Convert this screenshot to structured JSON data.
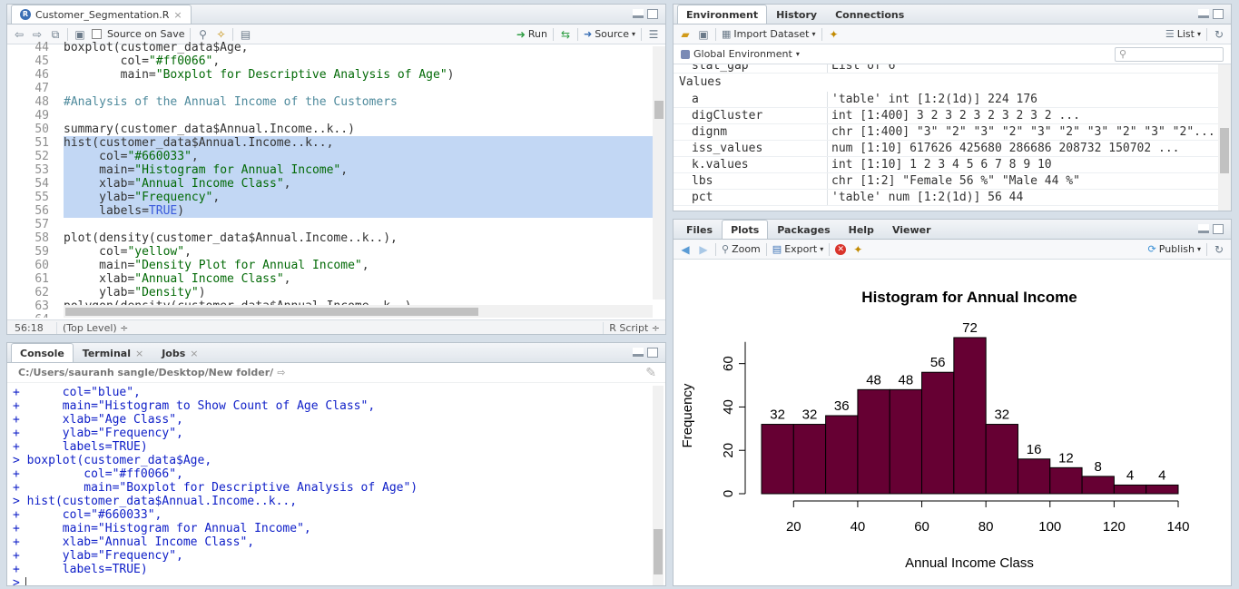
{
  "source_pane": {
    "tab_label": "Customer_Segmentation.R",
    "toolbar": {
      "source_on_save": "Source on Save",
      "run": "Run",
      "source": "Source"
    },
    "lines": [
      {
        "n": "44",
        "parts": [
          {
            "t": "boxplot(customer_data$Age,",
            "c": ""
          }
        ]
      },
      {
        "n": "45",
        "parts": [
          {
            "t": "        col=",
            "c": ""
          },
          {
            "t": "\"#ff0066\"",
            "c": "str"
          },
          {
            "t": ",",
            "c": ""
          }
        ]
      },
      {
        "n": "46",
        "parts": [
          {
            "t": "        main=",
            "c": ""
          },
          {
            "t": "\"Boxplot for Descriptive Analysis of Age\"",
            "c": "str"
          },
          {
            "t": ")",
            "c": ""
          }
        ]
      },
      {
        "n": "47",
        "parts": []
      },
      {
        "n": "48",
        "parts": [
          {
            "t": "#Analysis of the Annual Income of the Customers",
            "c": "com"
          }
        ]
      },
      {
        "n": "49",
        "parts": []
      },
      {
        "n": "50",
        "parts": [
          {
            "t": "summary(customer_data$Annual.Income..k..)",
            "c": ""
          }
        ]
      },
      {
        "n": "51",
        "hl": true,
        "parts": [
          {
            "t": "hist(customer_data$Annual.Income..k..,",
            "c": ""
          }
        ]
      },
      {
        "n": "52",
        "hl": true,
        "parts": [
          {
            "t": "     col=",
            "c": ""
          },
          {
            "t": "\"#660033\"",
            "c": "str"
          },
          {
            "t": ",",
            "c": ""
          }
        ]
      },
      {
        "n": "53",
        "hl": true,
        "parts": [
          {
            "t": "     main=",
            "c": ""
          },
          {
            "t": "\"Histogram for Annual Income\"",
            "c": "str"
          },
          {
            "t": ",",
            "c": ""
          }
        ]
      },
      {
        "n": "54",
        "hl": true,
        "parts": [
          {
            "t": "     xlab=",
            "c": ""
          },
          {
            "t": "\"Annual Income Class\"",
            "c": "str"
          },
          {
            "t": ",",
            "c": ""
          }
        ]
      },
      {
        "n": "55",
        "hl": true,
        "parts": [
          {
            "t": "     ylab=",
            "c": ""
          },
          {
            "t": "\"Frequency\"",
            "c": "str"
          },
          {
            "t": ",",
            "c": ""
          }
        ]
      },
      {
        "n": "56",
        "hl": true,
        "parts": [
          {
            "t": "     labels=",
            "c": ""
          },
          {
            "t": "TRUE",
            "c": "kw"
          },
          {
            "t": ")",
            "c": ""
          }
        ]
      },
      {
        "n": "57",
        "parts": []
      },
      {
        "n": "58",
        "parts": [
          {
            "t": "plot(density(customer_data$Annual.Income..k..),",
            "c": ""
          }
        ]
      },
      {
        "n": "59",
        "parts": [
          {
            "t": "     col=",
            "c": ""
          },
          {
            "t": "\"yellow\"",
            "c": "str"
          },
          {
            "t": ",",
            "c": ""
          }
        ]
      },
      {
        "n": "60",
        "parts": [
          {
            "t": "     main=",
            "c": ""
          },
          {
            "t": "\"Density Plot for Annual Income\"",
            "c": "str"
          },
          {
            "t": ",",
            "c": ""
          }
        ]
      },
      {
        "n": "61",
        "parts": [
          {
            "t": "     xlab=",
            "c": ""
          },
          {
            "t": "\"Annual Income Class\"",
            "c": "str"
          },
          {
            "t": ",",
            "c": ""
          }
        ]
      },
      {
        "n": "62",
        "parts": [
          {
            "t": "     ylab=",
            "c": ""
          },
          {
            "t": "\"Density\"",
            "c": "str"
          },
          {
            "t": ")",
            "c": ""
          }
        ]
      },
      {
        "n": "63",
        "parts": [
          {
            "t": "polygon(density(customer_data$Annual.Income..k..)",
            "c": ""
          }
        ]
      },
      {
        "n": "64",
        "parts": []
      }
    ],
    "status": {
      "position": "56:18",
      "scope": "(Top Level) ÷",
      "filetype": "R Script ÷"
    }
  },
  "console_pane": {
    "tabs": [
      "Console",
      "Terminal",
      "Jobs"
    ],
    "path": "C:/Users/sauranh sangle/Desktop/New folder/",
    "lines": [
      {
        "p": "+",
        "t": "      col=\"blue\","
      },
      {
        "p": "+",
        "t": "      main=\"Histogram to Show Count of Age Class\","
      },
      {
        "p": "+",
        "t": "      xlab=\"Age Class\","
      },
      {
        "p": "+",
        "t": "      ylab=\"Frequency\","
      },
      {
        "p": "+",
        "t": "      labels=TRUE)"
      },
      {
        "p": ">",
        "t": " boxplot(customer_data$Age,"
      },
      {
        "p": "+",
        "t": "         col=\"#ff0066\","
      },
      {
        "p": "+",
        "t": "         main=\"Boxplot for Descriptive Analysis of Age\")"
      },
      {
        "p": ">",
        "t": " hist(customer_data$Annual.Income..k..,"
      },
      {
        "p": "+",
        "t": "      col=\"#660033\","
      },
      {
        "p": "+",
        "t": "      main=\"Histogram for Annual Income\","
      },
      {
        "p": "+",
        "t": "      xlab=\"Annual Income Class\","
      },
      {
        "p": "+",
        "t": "      ylab=\"Frequency\","
      },
      {
        "p": "+",
        "t": "      labels=TRUE)"
      },
      {
        "p": ">",
        "t": ""
      }
    ]
  },
  "env_pane": {
    "tabs": [
      "Environment",
      "History",
      "Connections"
    ],
    "toolbar": {
      "import": "Import Dataset",
      "list": "List",
      "global": "Global Environment"
    },
    "top_row": {
      "name": "stat_gap",
      "value": "List of 6"
    },
    "section": "Values",
    "rows": [
      {
        "name": "a",
        "value": "'table' int [1:2(1d)] 224 176"
      },
      {
        "name": "digCluster",
        "value": "int [1:400] 3 2 3 2 3 2 3 2 3 2 ..."
      },
      {
        "name": "dignm",
        "value": "chr [1:400] \"3\" \"2\" \"3\" \"2\" \"3\" \"2\" \"3\" \"2\" \"3\" \"2\"..."
      },
      {
        "name": "iss_values",
        "value": "num [1:10] 617626 425680 286686 208732 150702 ..."
      },
      {
        "name": "k.values",
        "value": "int [1:10] 1 2 3 4 5 6 7 8 9 10"
      },
      {
        "name": "lbs",
        "value": "chr [1:2] \"Female 56 %\" \"Male 44 %\""
      },
      {
        "name": "pct",
        "value": "'table' num [1:2(1d)] 56 44"
      }
    ]
  },
  "plots_pane": {
    "tabs": [
      "Files",
      "Plots",
      "Packages",
      "Help",
      "Viewer"
    ],
    "toolbar": {
      "zoom": "Zoom",
      "export": "Export",
      "publish": "Publish"
    }
  },
  "chart_data": {
    "type": "bar",
    "title": "Histogram for Annual Income",
    "xlabel": "Annual Income Class",
    "ylabel": "Frequency",
    "bar_color": "#660033",
    "bins": [
      [
        10,
        20
      ],
      [
        20,
        30
      ],
      [
        30,
        40
      ],
      [
        40,
        50
      ],
      [
        50,
        60
      ],
      [
        60,
        70
      ],
      [
        70,
        80
      ],
      [
        80,
        90
      ],
      [
        90,
        100
      ],
      [
        100,
        110
      ],
      [
        110,
        120
      ],
      [
        120,
        130
      ],
      [
        130,
        140
      ]
    ],
    "values": [
      32,
      32,
      36,
      48,
      48,
      56,
      72,
      32,
      16,
      12,
      8,
      4,
      4
    ],
    "data_labels": [
      "32",
      "32",
      "36",
      "48",
      "48",
      "56",
      "72",
      "32",
      "16",
      "12",
      "8",
      "4",
      "4"
    ],
    "xticks": [
      "20",
      "40",
      "60",
      "80",
      "100",
      "120",
      "140"
    ],
    "yticks": [
      "0",
      "20",
      "40",
      "60"
    ],
    "xlim": [
      10,
      140
    ],
    "ylim": [
      0,
      72
    ]
  }
}
